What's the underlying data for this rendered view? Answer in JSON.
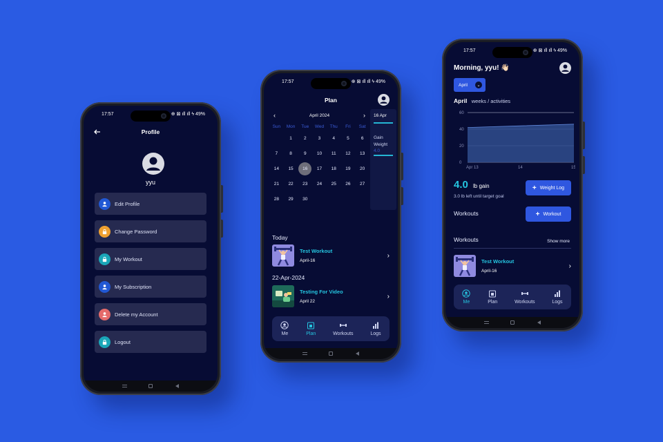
{
  "phone1": {
    "status_time": "17:57",
    "status_right": "⊕ ⊠ ıll ıll ϟ 49%",
    "title": "Profile",
    "username": "yyu",
    "menu": [
      {
        "label": "Edit Profile",
        "icon": "user-icon",
        "color": "#2158d4"
      },
      {
        "label": "Change Password",
        "icon": "lock-icon",
        "color": "#f0a030"
      },
      {
        "label": "My Workout",
        "icon": "lock-icon",
        "color": "#1aa6b8"
      },
      {
        "label": "My Subscription",
        "icon": "user-icon",
        "color": "#2158d4"
      },
      {
        "label": "Delete my Account",
        "icon": "user-icon",
        "color": "#e46a6a"
      },
      {
        "label": "Logout",
        "icon": "lock-icon",
        "color": "#1aa6b8"
      }
    ]
  },
  "phone2": {
    "status_time": "17:57",
    "status_right": "⊕ ⊠ ıll ıll ϟ 49%",
    "title": "Plan",
    "calendar": {
      "month_label": "April 2024",
      "dows": [
        "Sun",
        "Mon",
        "Tue",
        "Wed",
        "Thu",
        "Fri",
        "Sat"
      ],
      "selected_day": "16",
      "days": [
        "",
        "1",
        "2",
        "3",
        "4",
        "5",
        "6",
        "7",
        "8",
        "9",
        "10",
        "11",
        "12",
        "13",
        "14",
        "15",
        "16",
        "17",
        "18",
        "19",
        "20",
        "21",
        "22",
        "23",
        "24",
        "25",
        "26",
        "27",
        "28",
        "29",
        "30"
      ]
    },
    "side": {
      "date": "16 Apr",
      "gain_label": "Gain Weight",
      "gain_value": "4.0"
    },
    "today_label": "Today",
    "workout1": {
      "title": "Test Workout",
      "date": "April-16"
    },
    "date_label": "22-Apr-2024",
    "workout2": {
      "title": "Testing For Video",
      "date": "April 22"
    },
    "tabs": [
      "Me",
      "Plan",
      "Workouts",
      "Logs"
    ]
  },
  "phone3": {
    "status_time": "17:57",
    "status_right": "⊕ ⊠ ıll ıll ϟ 49%",
    "greeting": "Morning, yyu! 👋🏻",
    "month_button": "April",
    "sub_month": "April",
    "sub_text": "weeks / activities",
    "gain_value": "4.0",
    "gain_unit": "lb gain",
    "gain_note": "3.0 lb left until target goal",
    "weight_log_button": "Weight Log",
    "workouts_label": "Workouts",
    "workout_button": "Workout",
    "workouts_section": "Workouts",
    "show_more": "Show more",
    "workout1": {
      "title": "Test Workout",
      "date": "April-16"
    },
    "tabs": [
      "Me",
      "Plan",
      "Workouts",
      "Logs"
    ]
  },
  "chart_data": {
    "type": "area",
    "x": [
      "Apr 13",
      "14",
      "15"
    ],
    "values": [
      42,
      44,
      46
    ],
    "ylim": [
      0,
      60
    ],
    "yticks": [
      "0",
      "20",
      "40",
      "60"
    ],
    "xlabel": "",
    "ylabel": "",
    "title": "",
    "grid": true
  },
  "colors": {
    "background": "#2a5be3",
    "screen": "#070c34",
    "accent": "#25c5e0",
    "button": "#2f57e0"
  }
}
